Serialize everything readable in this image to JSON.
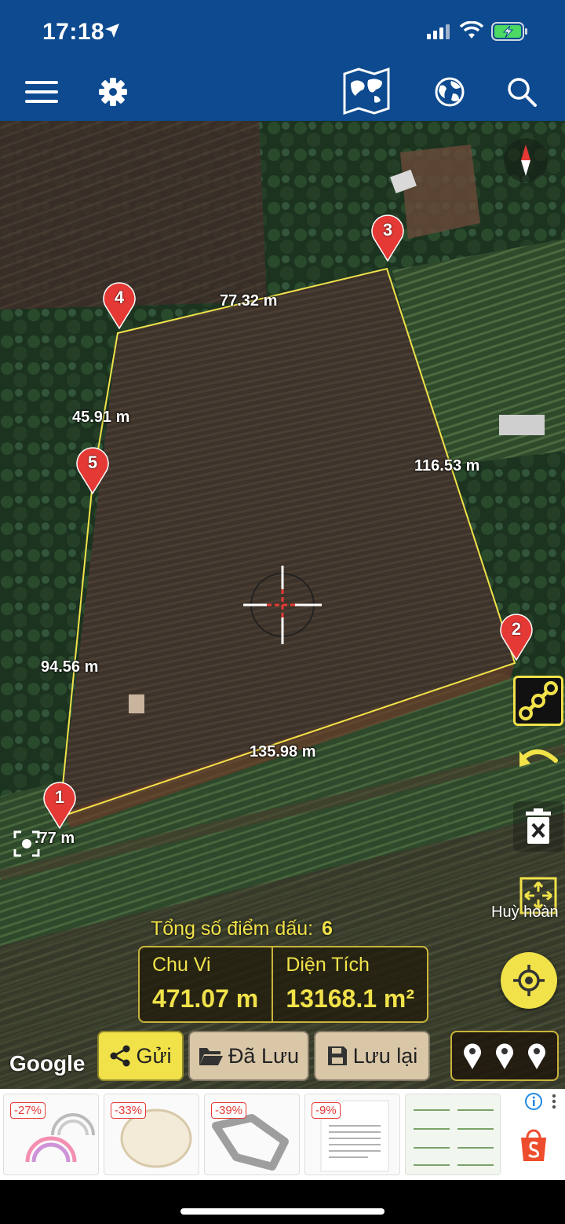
{
  "status_bar": {
    "time": "17:18"
  },
  "header": {
    "icons": [
      "menu-icon",
      "settings-icon",
      "map-layers-icon",
      "globe-icon",
      "search-icon"
    ]
  },
  "map": {
    "points": [
      {
        "label": "1"
      },
      {
        "label": "2"
      },
      {
        "label": "3"
      },
      {
        "label": "4"
      },
      {
        "label": "5"
      }
    ],
    "distances": [
      "77.32 m",
      "45.91 m",
      "116.53 m",
      "94.56 m",
      "135.98 m",
      ".77 m"
    ],
    "side_text": "Huỳ hoàn",
    "attribution": "Google",
    "colors": {
      "boundary": "#f1e24a",
      "pin": "#e53935",
      "accent": "#f1e24a",
      "header": "#0d4a8f"
    }
  },
  "stats": {
    "count_label": "Tổng số điểm dấu:",
    "count_value": "6",
    "perimeter_label": "Chu Vi",
    "perimeter_value": "471.07 m",
    "area_label": "Diện Tích",
    "area_value": "13168.1 m²"
  },
  "actions": {
    "send": "Gửi",
    "saved": "Đã Lưu",
    "save": "Lưu lại"
  },
  "ads": {
    "badges": [
      "-27%",
      "-33%",
      "-39%",
      "-9%"
    ]
  }
}
